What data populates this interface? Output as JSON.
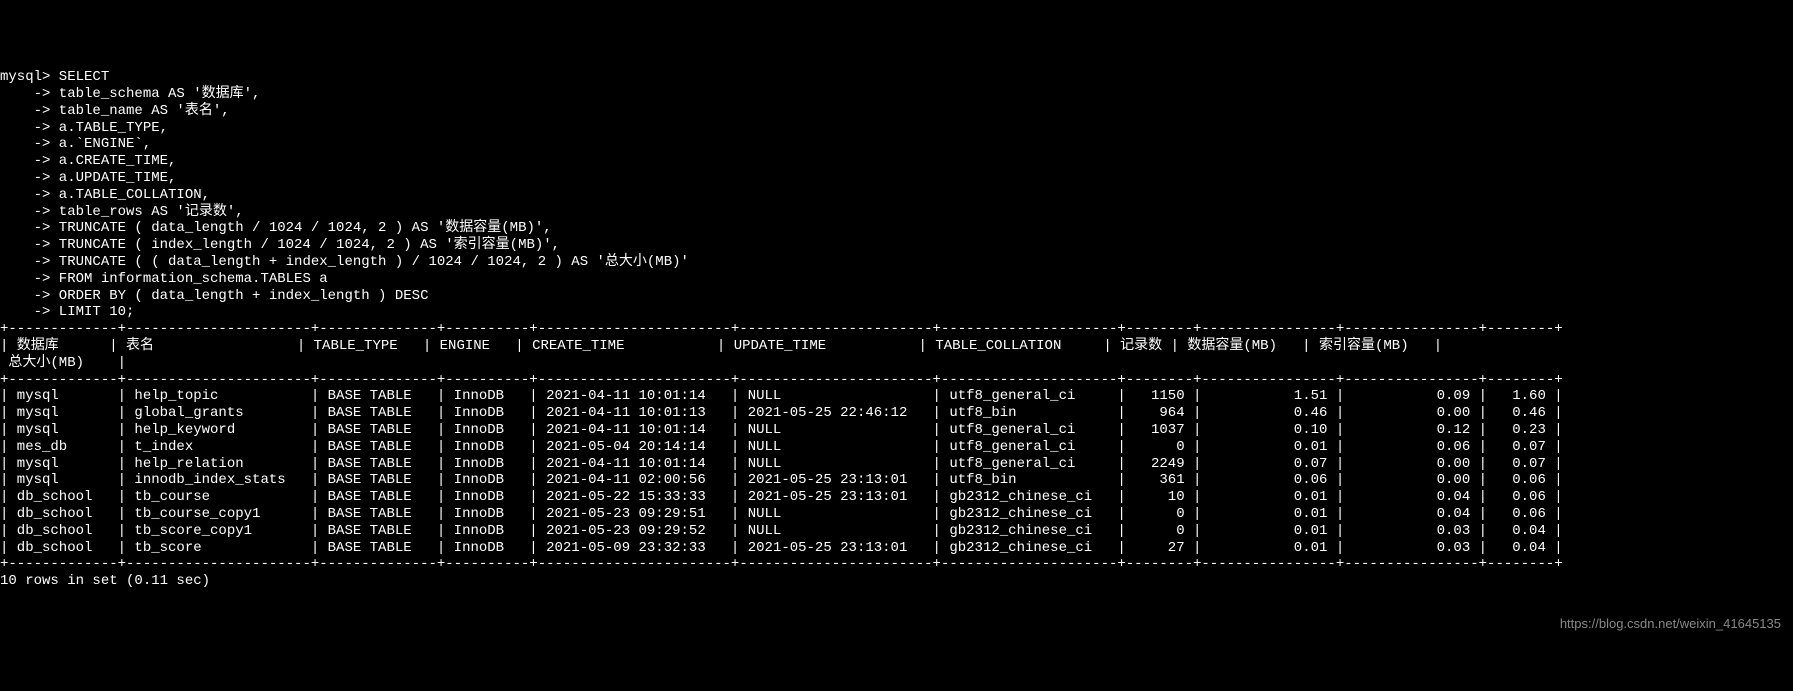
{
  "prompt": "mysql>",
  "cont": "->",
  "query_lines": [
    "SELECT",
    "table_schema AS '数据库',",
    "table_name AS '表名',",
    "a.TABLE_TYPE,",
    "a.`ENGINE`,",
    "a.CREATE_TIME,",
    "a.UPDATE_TIME,",
    "a.TABLE_COLLATION,",
    "table_rows AS '记录数',",
    "TRUNCATE ( data_length / 1024 / 1024, 2 ) AS '数据容量(MB)',",
    "TRUNCATE ( index_length / 1024 / 1024, 2 ) AS '索引容量(MB)',",
    "TRUNCATE ( ( data_length + index_length ) / 1024 / 1024, 2 ) AS '总大小(MB)'",
    "FROM information_schema.TABLES a",
    "ORDER BY ( data_length + index_length ) DESC",
    "LIMIT 10;"
  ],
  "headers": [
    "数据库",
    "表名",
    "TABLE_TYPE",
    "ENGINE",
    "CREATE_TIME",
    "UPDATE_TIME",
    "TABLE_COLLATION",
    "记录数",
    "数据容量(MB)",
    "索引容量(MB)",
    "总大小(MB)"
  ],
  "rows": [
    {
      "schema": "mysql",
      "table": "help_topic",
      "type": "BASE TABLE",
      "engine": "InnoDB",
      "create": "2021-04-11 10:01:14",
      "update": "NULL",
      "collation": "utf8_general_ci",
      "rows": "1150",
      "data": "1.51",
      "index": "0.09",
      "total": "1.60"
    },
    {
      "schema": "mysql",
      "table": "global_grants",
      "type": "BASE TABLE",
      "engine": "InnoDB",
      "create": "2021-04-11 10:01:13",
      "update": "2021-05-25 22:46:12",
      "collation": "utf8_bin",
      "rows": "964",
      "data": "0.46",
      "index": "0.00",
      "total": "0.46"
    },
    {
      "schema": "mysql",
      "table": "help_keyword",
      "type": "BASE TABLE",
      "engine": "InnoDB",
      "create": "2021-04-11 10:01:14",
      "update": "NULL",
      "collation": "utf8_general_ci",
      "rows": "1037",
      "data": "0.10",
      "index": "0.12",
      "total": "0.23"
    },
    {
      "schema": "mes_db",
      "table": "t_index",
      "type": "BASE TABLE",
      "engine": "InnoDB",
      "create": "2021-05-04 20:14:14",
      "update": "NULL",
      "collation": "utf8_general_ci",
      "rows": "0",
      "data": "0.01",
      "index": "0.06",
      "total": "0.07"
    },
    {
      "schema": "mysql",
      "table": "help_relation",
      "type": "BASE TABLE",
      "engine": "InnoDB",
      "create": "2021-04-11 10:01:14",
      "update": "NULL",
      "collation": "utf8_general_ci",
      "rows": "2249",
      "data": "0.07",
      "index": "0.00",
      "total": "0.07"
    },
    {
      "schema": "mysql",
      "table": "innodb_index_stats",
      "type": "BASE TABLE",
      "engine": "InnoDB",
      "create": "2021-04-11 02:00:56",
      "update": "2021-05-25 23:13:01",
      "collation": "utf8_bin",
      "rows": "361",
      "data": "0.06",
      "index": "0.00",
      "total": "0.06"
    },
    {
      "schema": "db_school",
      "table": "tb_course",
      "type": "BASE TABLE",
      "engine": "InnoDB",
      "create": "2021-05-22 15:33:33",
      "update": "2021-05-25 23:13:01",
      "collation": "gb2312_chinese_ci",
      "rows": "10",
      "data": "0.01",
      "index": "0.04",
      "total": "0.06"
    },
    {
      "schema": "db_school",
      "table": "tb_course_copy1",
      "type": "BASE TABLE",
      "engine": "InnoDB",
      "create": "2021-05-23 09:29:51",
      "update": "NULL",
      "collation": "gb2312_chinese_ci",
      "rows": "0",
      "data": "0.01",
      "index": "0.04",
      "total": "0.06"
    },
    {
      "schema": "db_school",
      "table": "tb_score_copy1",
      "type": "BASE TABLE",
      "engine": "InnoDB",
      "create": "2021-05-23 09:29:52",
      "update": "NULL",
      "collation": "gb2312_chinese_ci",
      "rows": "0",
      "data": "0.01",
      "index": "0.03",
      "total": "0.04"
    },
    {
      "schema": "db_school",
      "table": "tb_score",
      "type": "BASE TABLE",
      "engine": "InnoDB",
      "create": "2021-05-09 23:32:33",
      "update": "2021-05-25 23:13:01",
      "collation": "gb2312_chinese_ci",
      "rows": "27",
      "data": "0.01",
      "index": "0.03",
      "total": "0.04"
    }
  ],
  "footer": "10 rows in set (0.11 sec)",
  "watermark": "https://blog.csdn.net/weixin_41645135"
}
